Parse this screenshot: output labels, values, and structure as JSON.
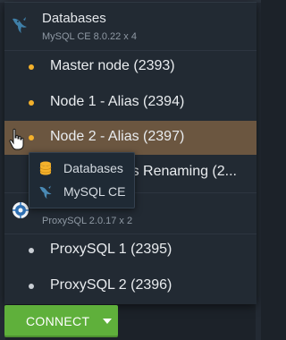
{
  "databases_group": {
    "title": "Databases",
    "subtitle": "MySQL CE 8.0.22 x 4",
    "icon": "mysql-dolphin-icon",
    "nodes": [
      {
        "label": "Master node (2393)",
        "bullet_color": "#f4b12b"
      },
      {
        "label": "Node 1 - Alias (2394)",
        "bullet_color": "#f4b12b"
      },
      {
        "label": "Node 2 - Alias (2397)",
        "bullet_color": "#f4b12b",
        "hovered": true
      },
      {
        "label": "Node 3 - Alias Renaming (2...",
        "bullet_color": "#f4b12b"
      }
    ]
  },
  "proxysql_group": {
    "title": "",
    "subtitle": "ProxySQL 2.0.17 x 2",
    "icon": "proxysql-icon",
    "nodes": [
      {
        "label": "ProxySQL 1 (2395)",
        "bullet_color": "#c9ced4"
      },
      {
        "label": "ProxySQL 2 (2396)",
        "bullet_color": "#c9ced4"
      }
    ]
  },
  "tooltip": {
    "items": [
      {
        "label": "Databases",
        "icon": "database-icon"
      },
      {
        "label": "MySQL CE",
        "icon": "mysql-dolphin-icon"
      }
    ]
  },
  "connect_button": {
    "label": "CONNECT",
    "color": "#5fb03b"
  },
  "colors": {
    "panel": "#222a33",
    "hover_row": "#6b5640",
    "accent_bullet": "#f4b12b"
  }
}
